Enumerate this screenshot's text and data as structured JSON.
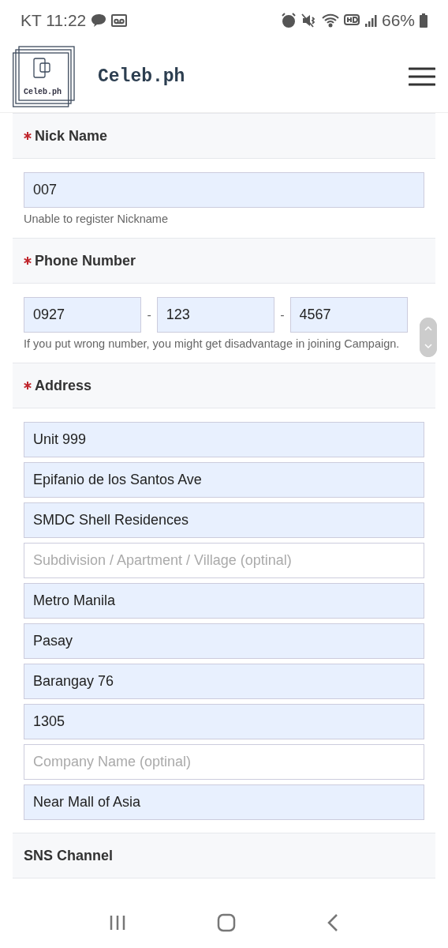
{
  "status_bar": {
    "carrier_time": "KT 11:22",
    "battery": "66%"
  },
  "header": {
    "logo_text": "Celeb.ph",
    "site_name": "Celeb.ph"
  },
  "sections": [
    {
      "title": "Nick Name",
      "required": true,
      "kind": "single",
      "fields": [
        {
          "value": "007"
        }
      ],
      "hint": "Unable to register Nickname"
    },
    {
      "title": "Phone Number",
      "required": true,
      "kind": "phone",
      "fields": [
        {
          "value": "0927"
        },
        {
          "value": "123"
        },
        {
          "value": "4567"
        }
      ],
      "separators": [
        "-",
        "-"
      ],
      "hint": "If you put wrong number, you might get disadvantage in joining Campaign."
    },
    {
      "title": "Address",
      "required": true,
      "kind": "stack",
      "fields": [
        {
          "value": "Unit 999"
        },
        {
          "value": "Epifanio de los Santos Ave"
        },
        {
          "value": "SMDC Shell Residences"
        },
        {
          "placeholder": "Subdivision / Apartment / Village (optinal)"
        },
        {
          "value": "Metro Manila"
        },
        {
          "value": "Pasay"
        },
        {
          "value": "Barangay 76"
        },
        {
          "value": "1305"
        },
        {
          "placeholder": "Company Name (optinal)"
        },
        {
          "value": "Near Mall of Asia"
        }
      ]
    },
    {
      "title": "SNS Channel",
      "required": false
    }
  ]
}
